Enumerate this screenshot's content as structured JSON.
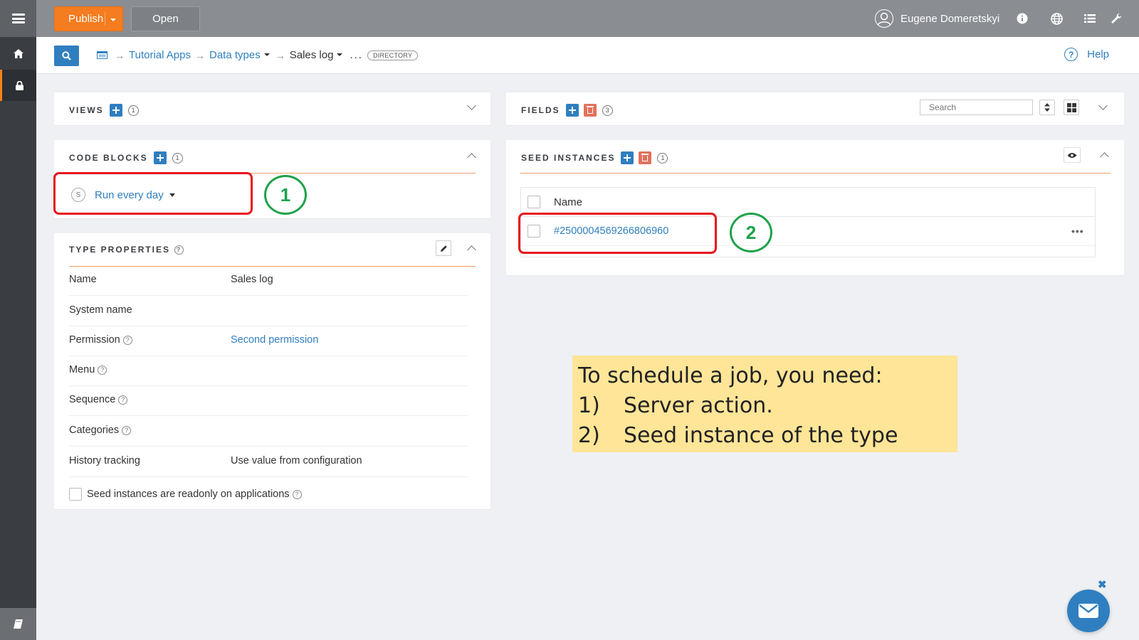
{
  "rail": {
    "menu_icon": "hamburger-icon",
    "items": [
      {
        "icon": "home-icon",
        "active": false
      },
      {
        "icon": "lock-icon",
        "active": true
      }
    ],
    "bottom_icon": "book-icon"
  },
  "topbar": {
    "publish_label": "Publish",
    "open_label": "Open",
    "user_name": "Eugene Domeretskyi",
    "icons": [
      "info-icon",
      "globe-icon",
      "list-icon",
      "wrench-icon"
    ]
  },
  "subhead": {
    "breadcrumb": {
      "item1": "Tutorial Apps",
      "item2": "Data types",
      "item3": "Sales log",
      "dots": "...",
      "badge": "DIRECTORY"
    },
    "help_label": "Help"
  },
  "views": {
    "title": "VIEWS",
    "count": "1"
  },
  "code_blocks": {
    "title": "CODE BLOCKS",
    "count": "1",
    "item": {
      "badge": "S",
      "label": "Run every day"
    }
  },
  "type_properties": {
    "title": "TYPE PROPERTIES",
    "rows": [
      {
        "key": "Name",
        "value": "Sales log"
      },
      {
        "key": "System name",
        "value": ""
      },
      {
        "key": "Permission",
        "value": "Second permission"
      },
      {
        "key": "Menu",
        "value": ""
      },
      {
        "key": "Sequence",
        "value": ""
      },
      {
        "key": "Categories",
        "value": ""
      },
      {
        "key": "History tracking",
        "value": "Use value from configuration"
      }
    ],
    "checkbox_label": "Seed instances are readonly on applications"
  },
  "fields": {
    "title": "FIELDS",
    "count": "3",
    "search_placeholder": "Search"
  },
  "seed_instances": {
    "title": "SEED INSTANCES",
    "count": "1",
    "column": "Name",
    "rows": [
      {
        "id": "#2500004569266806960"
      }
    ]
  },
  "annotations": {
    "circle1": "1",
    "circle2": "2",
    "note": {
      "line1": "To schedule a job, you need:",
      "item1_num": "1)",
      "item1_text": "Server action.",
      "item2_num": "2)",
      "item2_text": "Seed instance of the type"
    }
  },
  "colors": {
    "accent": "#2f7fc0",
    "publish": "#f57c1f",
    "annotation_red": "#e8141e",
    "annotation_green": "#1ea24a",
    "note_bg": "#ffe597"
  }
}
